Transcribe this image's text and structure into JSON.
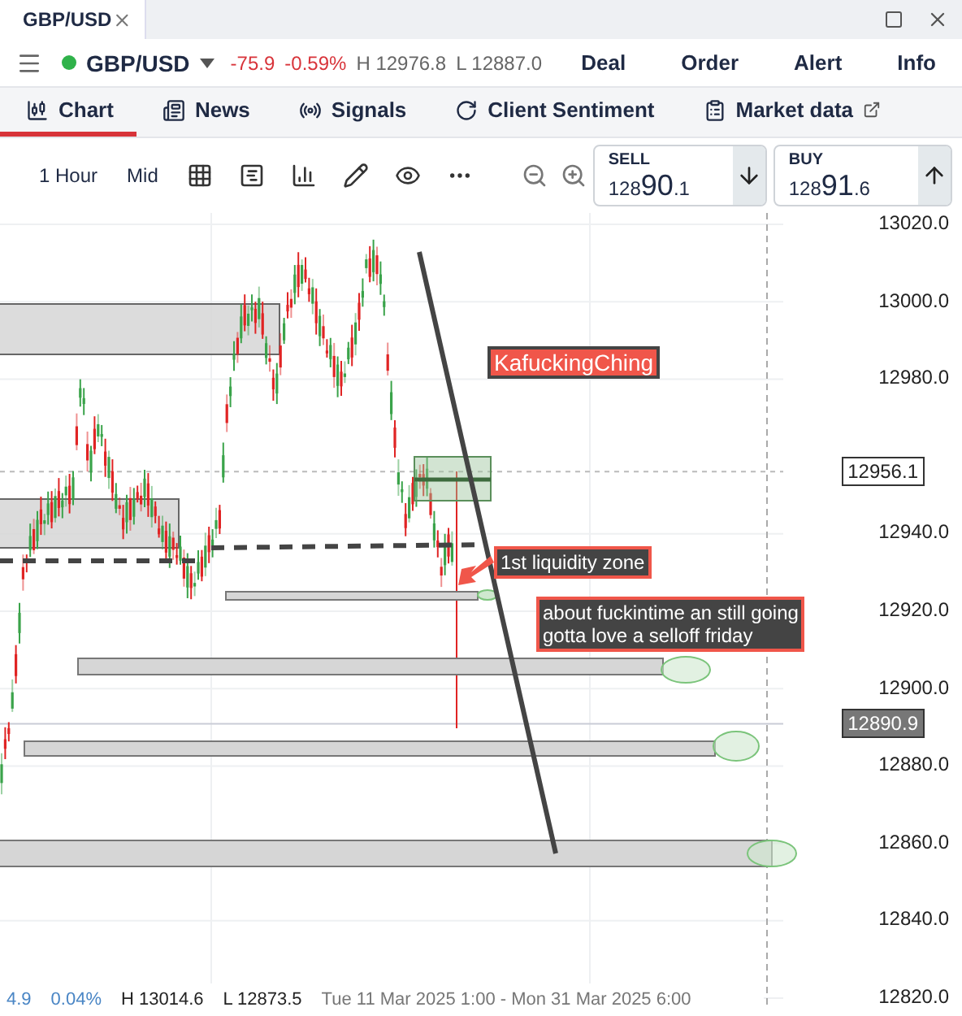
{
  "window": {
    "tab_title": "GBP/USD"
  },
  "instrument": {
    "name": "GBP/USD",
    "change": "-75.9",
    "change_percent": "-0.59%",
    "high": "H 12976.8",
    "low": "L 12887.0"
  },
  "actions": [
    "Deal",
    "Order",
    "Alert",
    "Info"
  ],
  "tabs": [
    {
      "label": "Chart",
      "selected": true
    },
    {
      "label": "News",
      "selected": false
    },
    {
      "label": "Signals",
      "selected": false
    },
    {
      "label": "Client Sentiment",
      "selected": false
    },
    {
      "label": "Market data",
      "selected": false
    }
  ],
  "toolbar": {
    "interval": "1 Hour",
    "price_type": "Mid"
  },
  "quotes": [
    {
      "kind": "sell",
      "label": "SELL",
      "prefix": "128",
      "main": "90",
      "suffix": ".1"
    },
    {
      "kind": "buy",
      "label": "BUY",
      "prefix": "128",
      "main": "91",
      "suffix": ".6"
    }
  ],
  "chart": {
    "price_axis": [
      "13020.0",
      "13000.0",
      "12980.0",
      "12940.0",
      "12920.0",
      "12900.0",
      "12880.0",
      "12860.0",
      "12840.0",
      "12820.0"
    ],
    "marker_price": "12956.1",
    "current_price": "12890.9",
    "annotations": [
      {
        "kind": "callout",
        "text": "KafuckingChing"
      },
      {
        "kind": "label",
        "text": "1st liquidity zone"
      },
      {
        "kind": "note",
        "lines": [
          "about fuckintime an still going",
          "gotta love a selloff friday"
        ]
      }
    ]
  },
  "status": {
    "change": "4.9",
    "change_percent": "0.04%",
    "high": "H 13014.6",
    "low": "L 12873.5",
    "range": "Tue 11 Mar 2025 1:00 - Mon 31 Mar 2025 6:00"
  }
}
